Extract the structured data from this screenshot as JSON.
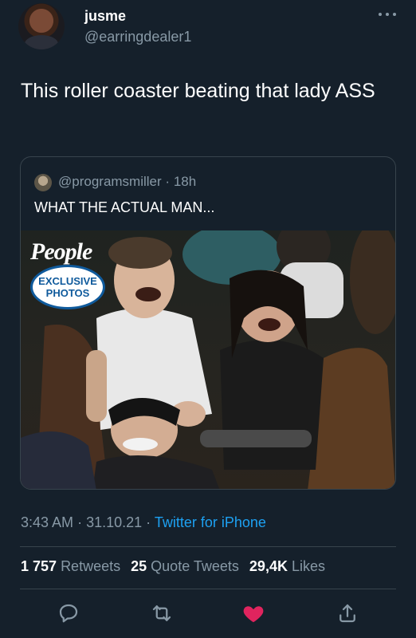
{
  "author": {
    "display_name": "jusme",
    "handle": "@earringdealer1"
  },
  "tweet": {
    "text": "This roller coaster beating that lady ASS"
  },
  "quote": {
    "handle": "@programsmiller",
    "separator": "·",
    "age": "18h",
    "text": "WHAT THE ACTUAL MAN...",
    "photo": {
      "brand": "People",
      "badge_line1": "EXCLUSIVE",
      "badge_line2": "PHOTOS"
    }
  },
  "meta": {
    "time": "3:43 AM",
    "separator": "·",
    "date": "31.10.21",
    "source": "Twitter for iPhone"
  },
  "stats": {
    "retweets_count": "1 757",
    "retweets_label": "Retweets",
    "quotes_count": "25",
    "quotes_label": "Quote Tweets",
    "likes_count": "29,4K",
    "likes_label": "Likes"
  },
  "colors": {
    "background": "#15202b",
    "secondary_text": "#8899a6",
    "link": "#1da1f2",
    "like": "#e0245e",
    "border": "#38444d"
  },
  "icons": [
    "more-icon",
    "reply-icon",
    "retweet-icon",
    "like-icon",
    "share-icon"
  ]
}
